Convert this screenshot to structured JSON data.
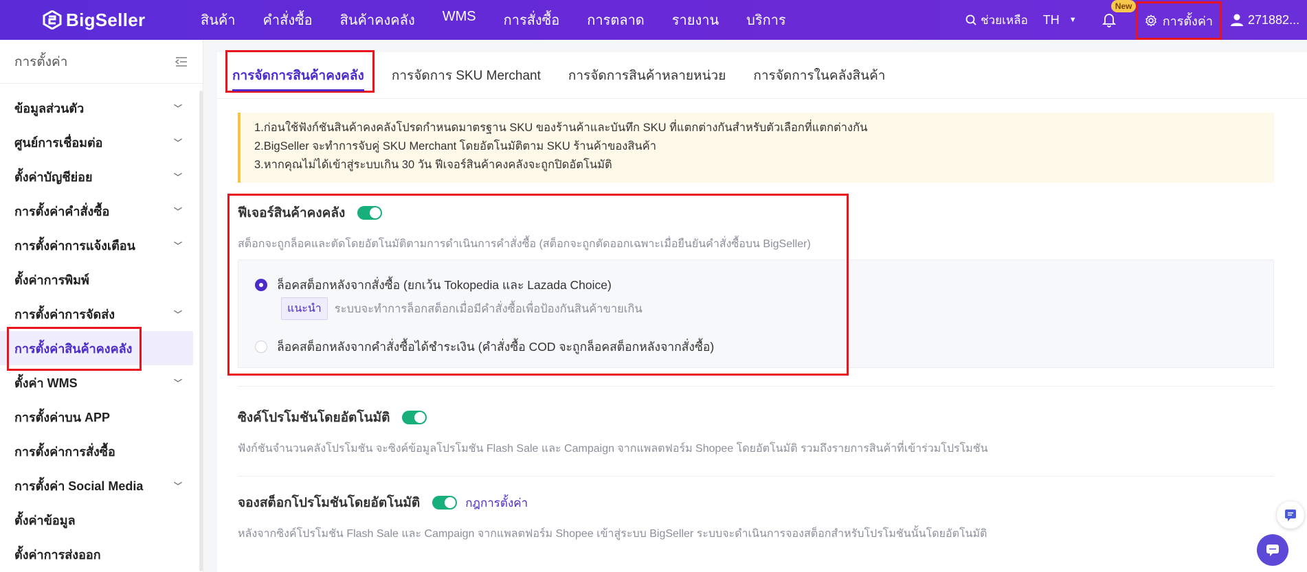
{
  "brand": {
    "name": "BigSeller"
  },
  "nav": [
    "สินค้า",
    "คำสั่งซื้อ",
    "สินค้าคงคลัง",
    "WMS",
    "การสั่งซื้อ",
    "การตลาด",
    "รายงาน",
    "บริการ"
  ],
  "header": {
    "help": "ช่วยเหลือ",
    "lang": "TH",
    "new_badge": "New",
    "settings": "การตั้งค่า",
    "user": "271882..."
  },
  "sidebar": {
    "title": "การตั้งค่า",
    "items": [
      {
        "label": "ข้อมูลส่วนตัว",
        "expandable": true
      },
      {
        "label": "ศูนย์การเชื่อมต่อ",
        "expandable": true
      },
      {
        "label": "ตั้งค่าบัญชีย่อย",
        "expandable": true
      },
      {
        "label": "การตั้งค่าคำสั่งซื้อ",
        "expandable": true
      },
      {
        "label": "การตั้งค่าการแจ้งเตือน",
        "expandable": true
      },
      {
        "label": "ตั้งค่าการพิมพ์",
        "expandable": false
      },
      {
        "label": "การตั้งค่าการจัดส่ง",
        "expandable": true
      },
      {
        "label": "การตั้งค่าสินค้าคงคลัง",
        "expandable": false,
        "active": true
      },
      {
        "label": "ตั้งค่า WMS",
        "expandable": true
      },
      {
        "label": "การตั้งค่าบน APP",
        "expandable": false
      },
      {
        "label": "การตั้งค่าการสั่งซื้อ",
        "expandable": false
      },
      {
        "label": "การตั้งค่า Social Media",
        "expandable": true
      },
      {
        "label": "ตั้งค่าข้อมูล",
        "expandable": false
      },
      {
        "label": "ตั้งค่าการส่งออก",
        "expandable": false
      }
    ]
  },
  "tabs": [
    "การจัดการสินค้าคงคลัง",
    "การจัดการ SKU Merchant",
    "การจัดการสินค้าหลายหน่วย",
    "การจัดการในคลังสินค้า"
  ],
  "notice": [
    "1.ก่อนใช้ฟังก์ชันสินค้าคงคลังโปรดกำหนดมาตรฐาน SKU ของร้านค้าและบันทึก SKU ที่แตกต่างกันสำหรับตัวเลือกที่แตกต่างกัน",
    "2.BigSeller จะทำการจับคู่ SKU Merchant โดยอัตโนมัติตาม SKU ร้านค้าของสินค้า",
    "3.หากคุณไม่ได้เข้าสู่ระบบเกิน 30 วัน ฟีเจอร์สินค้าคงคลังจะถูกปิดอัตโนมัติ"
  ],
  "inventory_feature": {
    "title": "ฟีเจอร์สินค้าคงคลัง",
    "enabled": true,
    "desc": "สต็อกจะถูกล็อคและตัดโดยอัตโนมัติตามการดำเนินการคำสั่งซื้อ (สต็อกจะถูกตัดออกเฉพาะเมื่อยืนยันคำสั่งซื้อบน BigSeller)",
    "option1": "ล็อคสต็อกหลังจากสั่งซื้อ (ยกเว้น Tokopedia และ Lazada Choice)",
    "option1_selected": true,
    "tip_badge": "แนะนำ",
    "tip_text": "ระบบจะทำการล็อกสต็อกเมื่อมีคำสั่งซื้อเพื่อป้องกันสินค้าขายเกิน",
    "option2": "ล็อคสต็อกหลังจากคำสั่งซื้อได้ชำระเงิน (คำสั่งซื้อ COD จะถูกล็อคสต็อกหลังจากสั่งซื้อ)"
  },
  "promo_sync": {
    "title": "ซิงค์โปรโมชันโดยอัตโนมัติ",
    "enabled": true,
    "desc": "ฟังก์ชันจำนวนคลังโปรโมชัน จะซิงค์ข้อมูลโปรโมชัน Flash Sale และ Campaign จากแพลตฟอร์ม Shopee โดยอัตโนมัติ รวมถึงรายการสินค้าที่เข้าร่วมโปรโมชัน"
  },
  "promo_reserve": {
    "title": "จองสต็อกโปรโมชันโดยอัตโนมัติ",
    "enabled": true,
    "rule_link": "กฎการตั้งค่า",
    "desc": "หลังจากซิงค์โปรโมชัน Flash Sale และ Campaign จากแพลตฟอร์ม Shopee เข้าสู่ระบบ BigSeller ระบบจะดำเนินการจองสต็อกสำหรับโปรโมชันนั้นโดยอัตโนมัติ"
  }
}
